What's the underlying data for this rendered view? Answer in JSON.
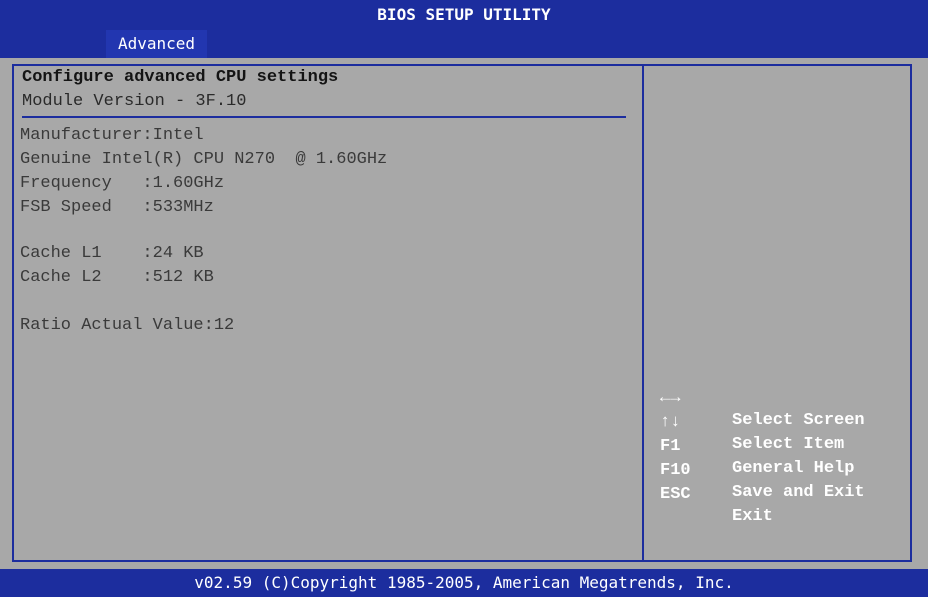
{
  "header": {
    "title": "BIOS SETUP UTILITY",
    "active_tab": "Advanced"
  },
  "main": {
    "heading": "Configure advanced CPU settings",
    "module_version": "Module Version - 3F.10",
    "lines": [
      "Manufacturer:Intel",
      "Genuine Intel(R) CPU N270  @ 1.60GHz",
      "Frequency   :1.60GHz",
      "FSB Speed   :533MHz",
      "Cache L1    :24 KB",
      "Cache L2    :512 KB",
      "Ratio Actual Value:12"
    ]
  },
  "help": [
    {
      "key": "←→",
      "desc": "Select Screen"
    },
    {
      "key": "↑↓",
      "desc": "Select Item"
    },
    {
      "key": "F1",
      "desc": "General Help"
    },
    {
      "key": "F10",
      "desc": "Save and Exit"
    },
    {
      "key": "ESC",
      "desc": "Exit"
    }
  ],
  "footer": {
    "text": "v02.59 (C)Copyright 1985-2005, American Megatrends, Inc."
  },
  "colors": {
    "bios_blue": "#1c2d9e",
    "background_gray": "#a8a8a8",
    "text_white": "#ffffff"
  }
}
